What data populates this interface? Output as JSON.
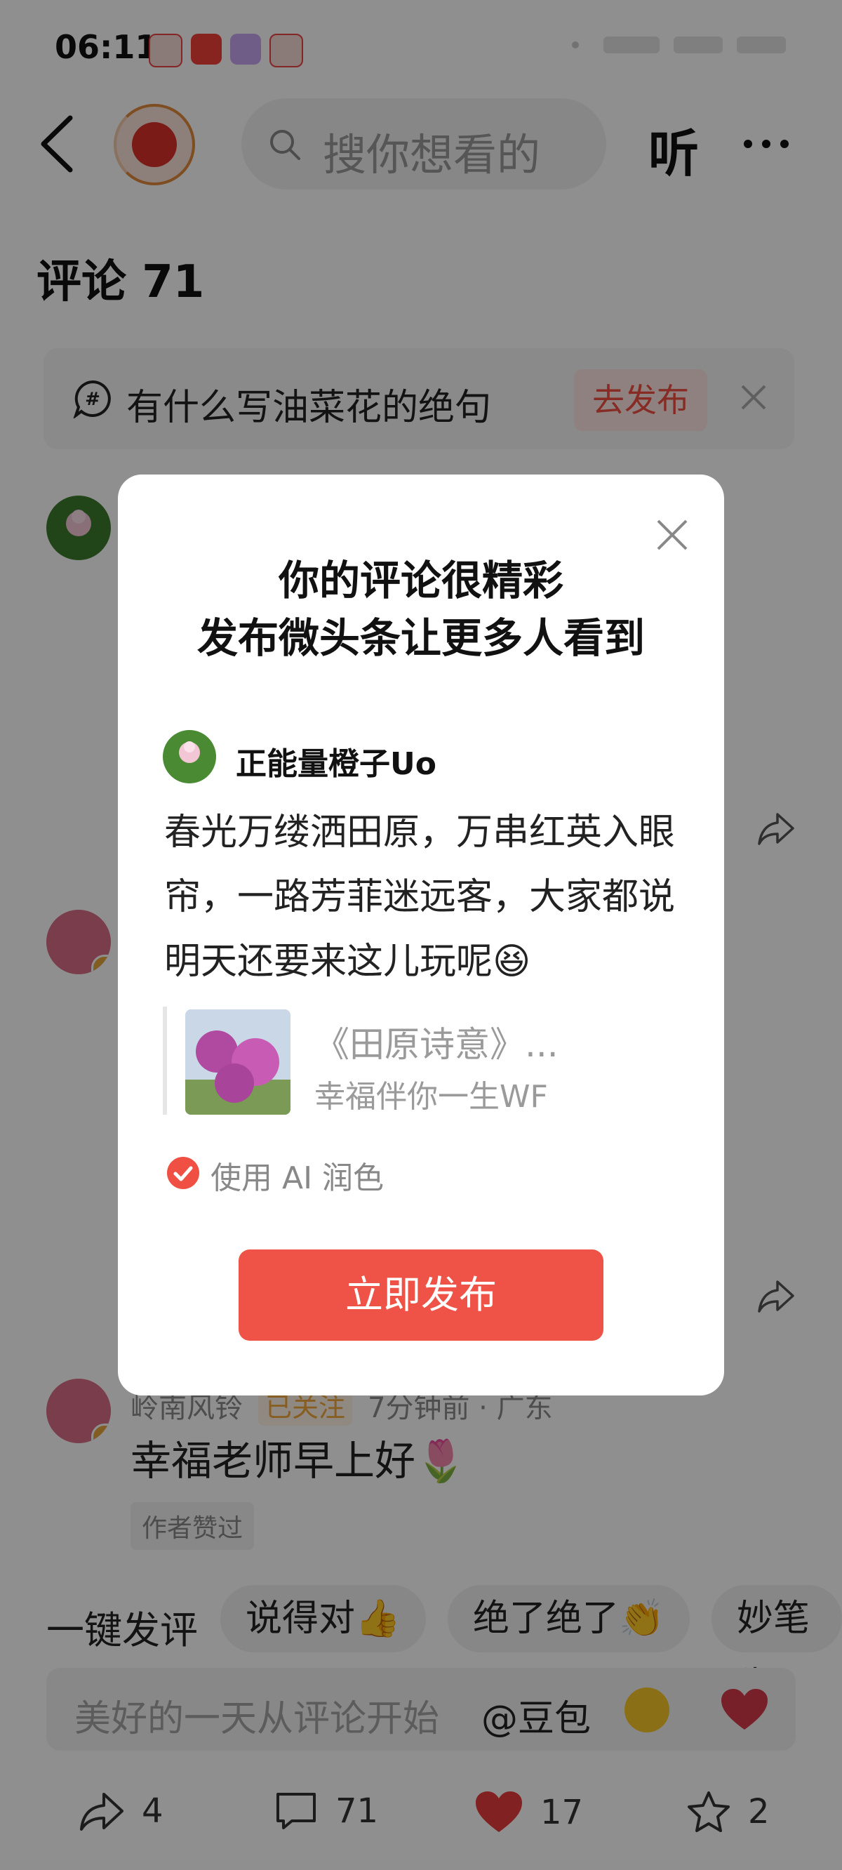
{
  "status_bar": {
    "time": "06:11"
  },
  "nav": {
    "search_placeholder": "搜你想看的",
    "listen_label": "听"
  },
  "comments_header": {
    "title": "评论 71"
  },
  "topic_banner": {
    "text": "有什么写油菜花的绝句",
    "button": "去发布"
  },
  "comments": [
    {
      "name": "岭南风铃",
      "tag": "已关注",
      "meta": "7分钟前 · 广东",
      "text": "幸福老师早上好🌷",
      "chip": "作者赞过"
    }
  ],
  "quick_reply": {
    "label": "一键发评",
    "chips": [
      "说得对👍",
      "绝了绝了👏",
      "妙笔生"
    ]
  },
  "input": {
    "placeholder": "美好的一天从评论开始",
    "mention": "@豆包"
  },
  "bottom_bar": {
    "share_count": "4",
    "comment_count": "71",
    "like_count": "17",
    "fav_count": "2"
  },
  "modal": {
    "title_line1": "你的评论很精彩",
    "title_line2": "发布微头条让更多人看到",
    "username": "正能量橙子Uo",
    "text": "春光万缕洒田原，万串红英入眼帘，一路芳菲迷远客，大家都说明天还要来这儿玩呢😆",
    "quote_title": "《田原诗意》...",
    "quote_author": "幸福伴你一生WF",
    "ai_option": "使用 AI 润色",
    "publish_button": "立即发布"
  },
  "colors": {
    "accent": "#ef5246",
    "mask": "rgba(0,0,0,0.44)"
  }
}
